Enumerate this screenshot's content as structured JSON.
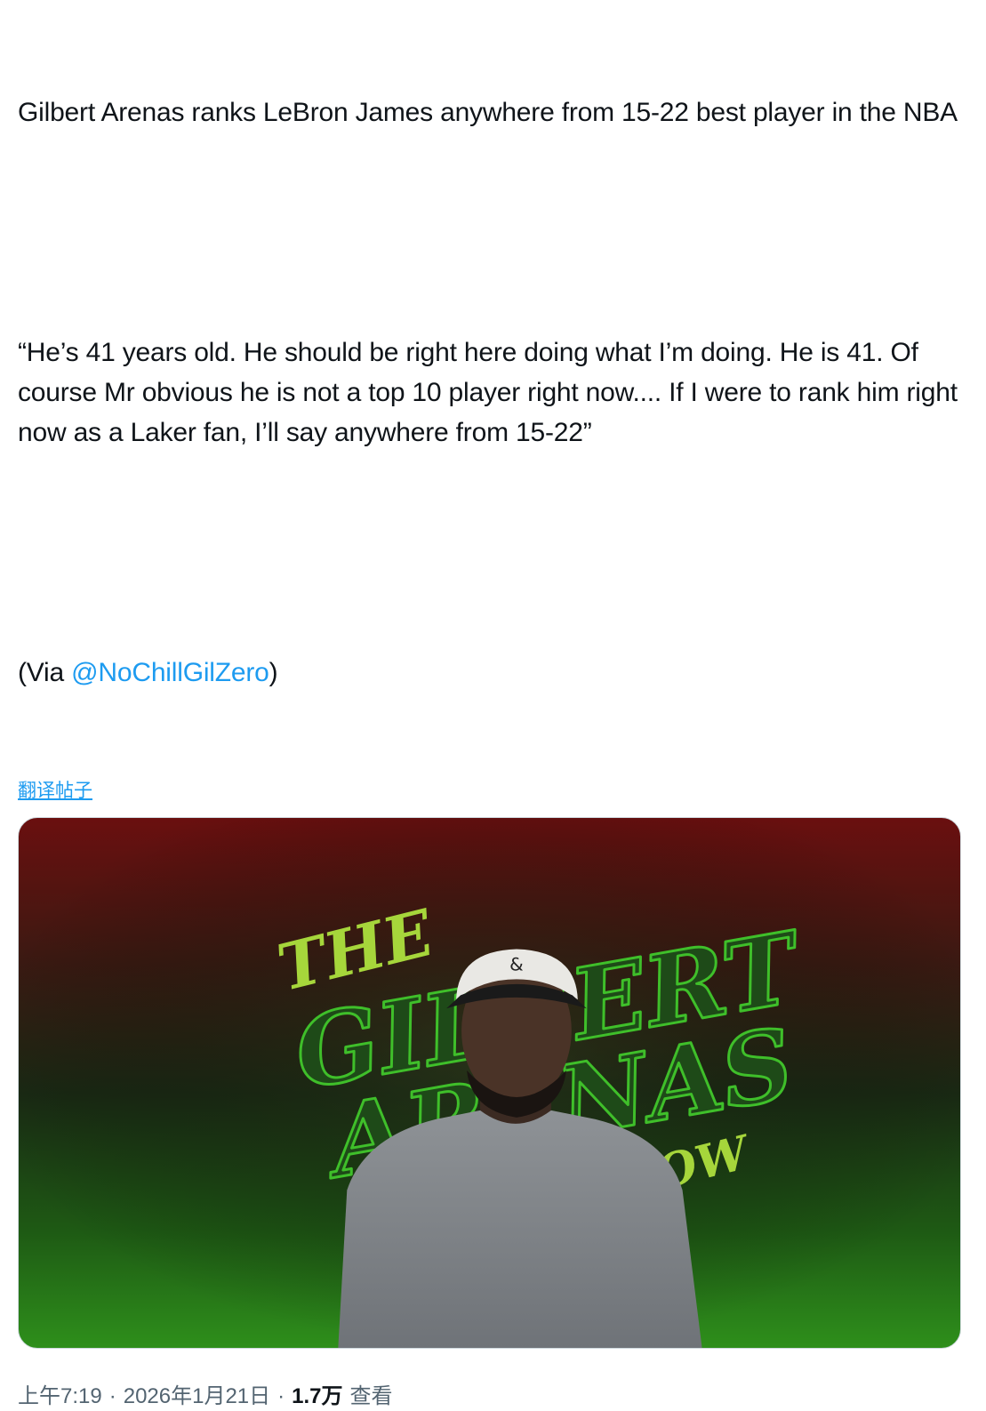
{
  "tweet": {
    "headline": "Gilbert Arenas ranks LeBron James anywhere from 15-22 best player in the NBA",
    "quote": "“He’s 41 years old. He should be right here doing what I’m doing. He is 41. Of course Mr obvious he is not a top 10 player right now.... If I were to rank him right now as a Laker fan, I’ll say anywhere from 15-22”",
    "via_prefix": "(Via ",
    "mention": "@NoChillGilZero",
    "via_suffix": ")",
    "translate_label": "翻译帖子"
  },
  "media": {
    "logo_text_1": "THE",
    "logo_text_2": "GILBERT",
    "logo_text_3": "ARENAS",
    "logo_text_4": "SHOW",
    "cap_logo": "&",
    "colors": {
      "top": "#6a0f0f",
      "bottom": "#2e8f1b",
      "logo_green": "#3fbf2a"
    }
  },
  "meta": {
    "time": "上午7:19",
    "separator": "·",
    "date": "2026年1月21日",
    "views_count": "1.7万",
    "views_label": "查看"
  }
}
